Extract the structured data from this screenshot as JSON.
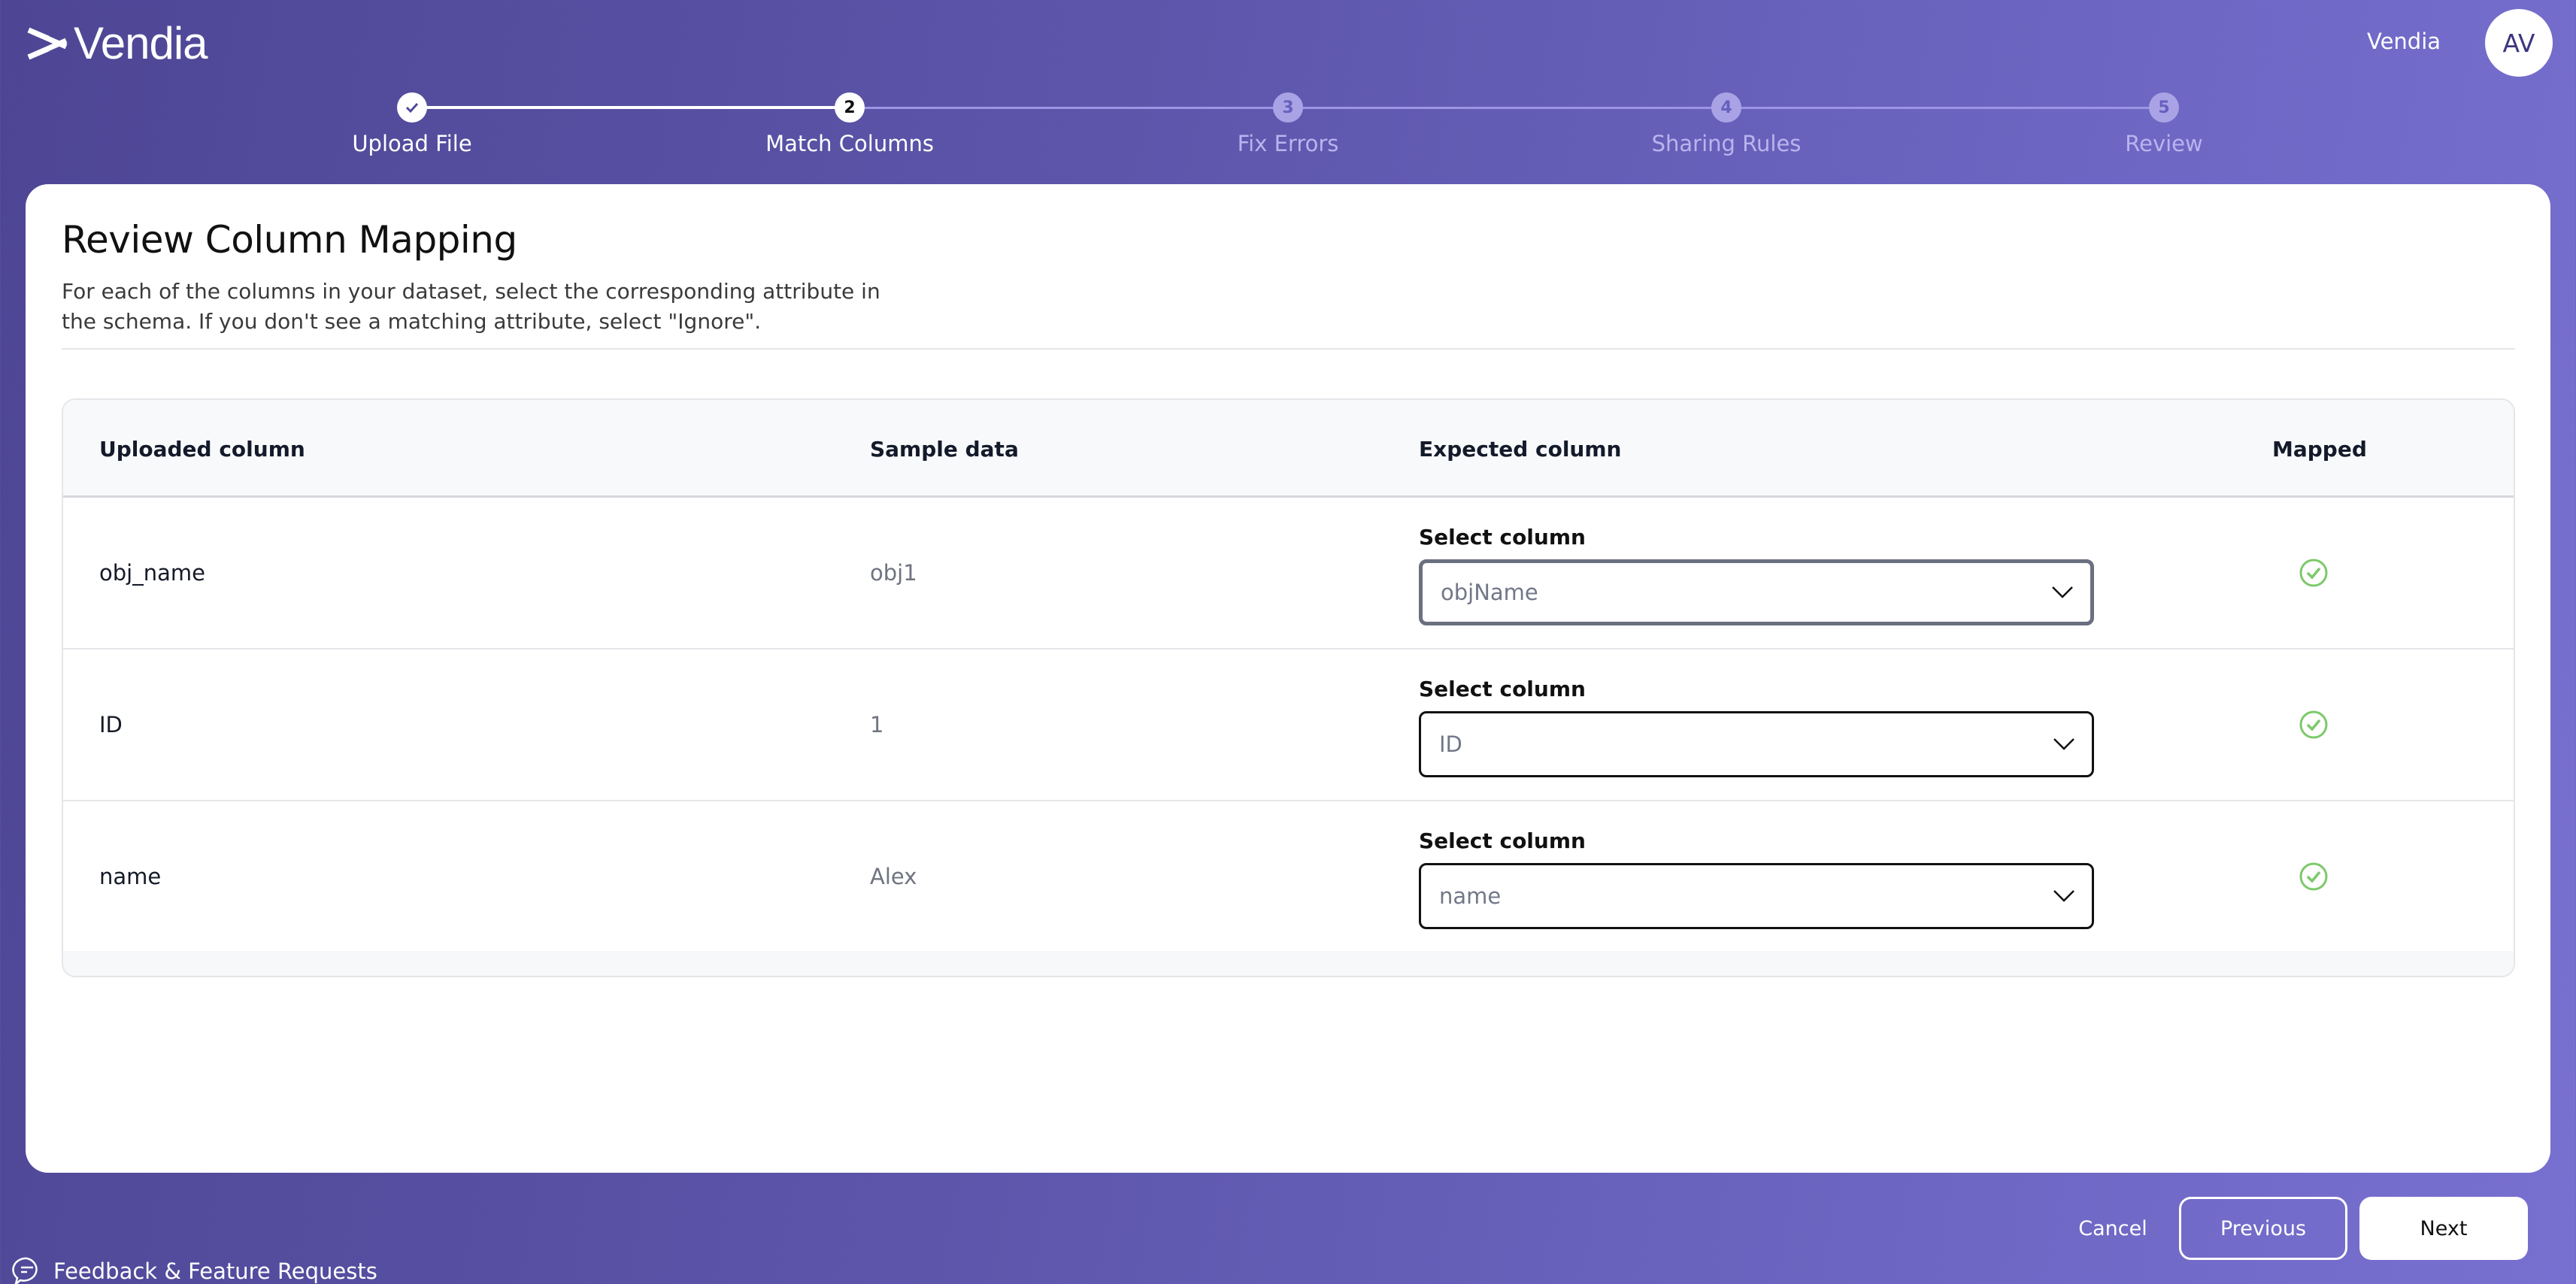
{
  "header": {
    "logo_text": "Vendia",
    "org_name": "Vendia",
    "avatar_initials": "AV"
  },
  "stepper": {
    "steps": [
      {
        "number": "1",
        "label": "Upload File",
        "state": "done"
      },
      {
        "number": "2",
        "label": "Match Columns",
        "state": "active"
      },
      {
        "number": "3",
        "label": "Fix Errors",
        "state": "todo"
      },
      {
        "number": "4",
        "label": "Sharing Rules",
        "state": "todo"
      },
      {
        "number": "5",
        "label": "Review",
        "state": "todo"
      }
    ]
  },
  "page": {
    "title": "Review Column Mapping",
    "description": "For each of the columns in your dataset, select the corresponding attribute in the schema. If you don't see a matching attribute, select \"Ignore\"."
  },
  "table": {
    "headers": {
      "uploaded": "Uploaded column",
      "sample": "Sample data",
      "expected": "Expected column",
      "mapped": "Mapped"
    },
    "rows": [
      {
        "uploaded": "obj_name",
        "sample": "obj1",
        "select_label": "Select column",
        "selected": "objName",
        "mapped": true
      },
      {
        "uploaded": "ID",
        "sample": "1",
        "select_label": "Select column",
        "selected": "ID",
        "mapped": true
      },
      {
        "uploaded": "name",
        "sample": "Alex",
        "select_label": "Select column",
        "selected": "name",
        "mapped": true
      }
    ]
  },
  "footer": {
    "cancel_label": "Cancel",
    "previous_label": "Previous",
    "next_label": "Next",
    "feedback_label": "Feedback & Feature Requests"
  },
  "colors": {
    "mapped_check": "#7cc96b",
    "brand_purple": "#5c55aa"
  }
}
